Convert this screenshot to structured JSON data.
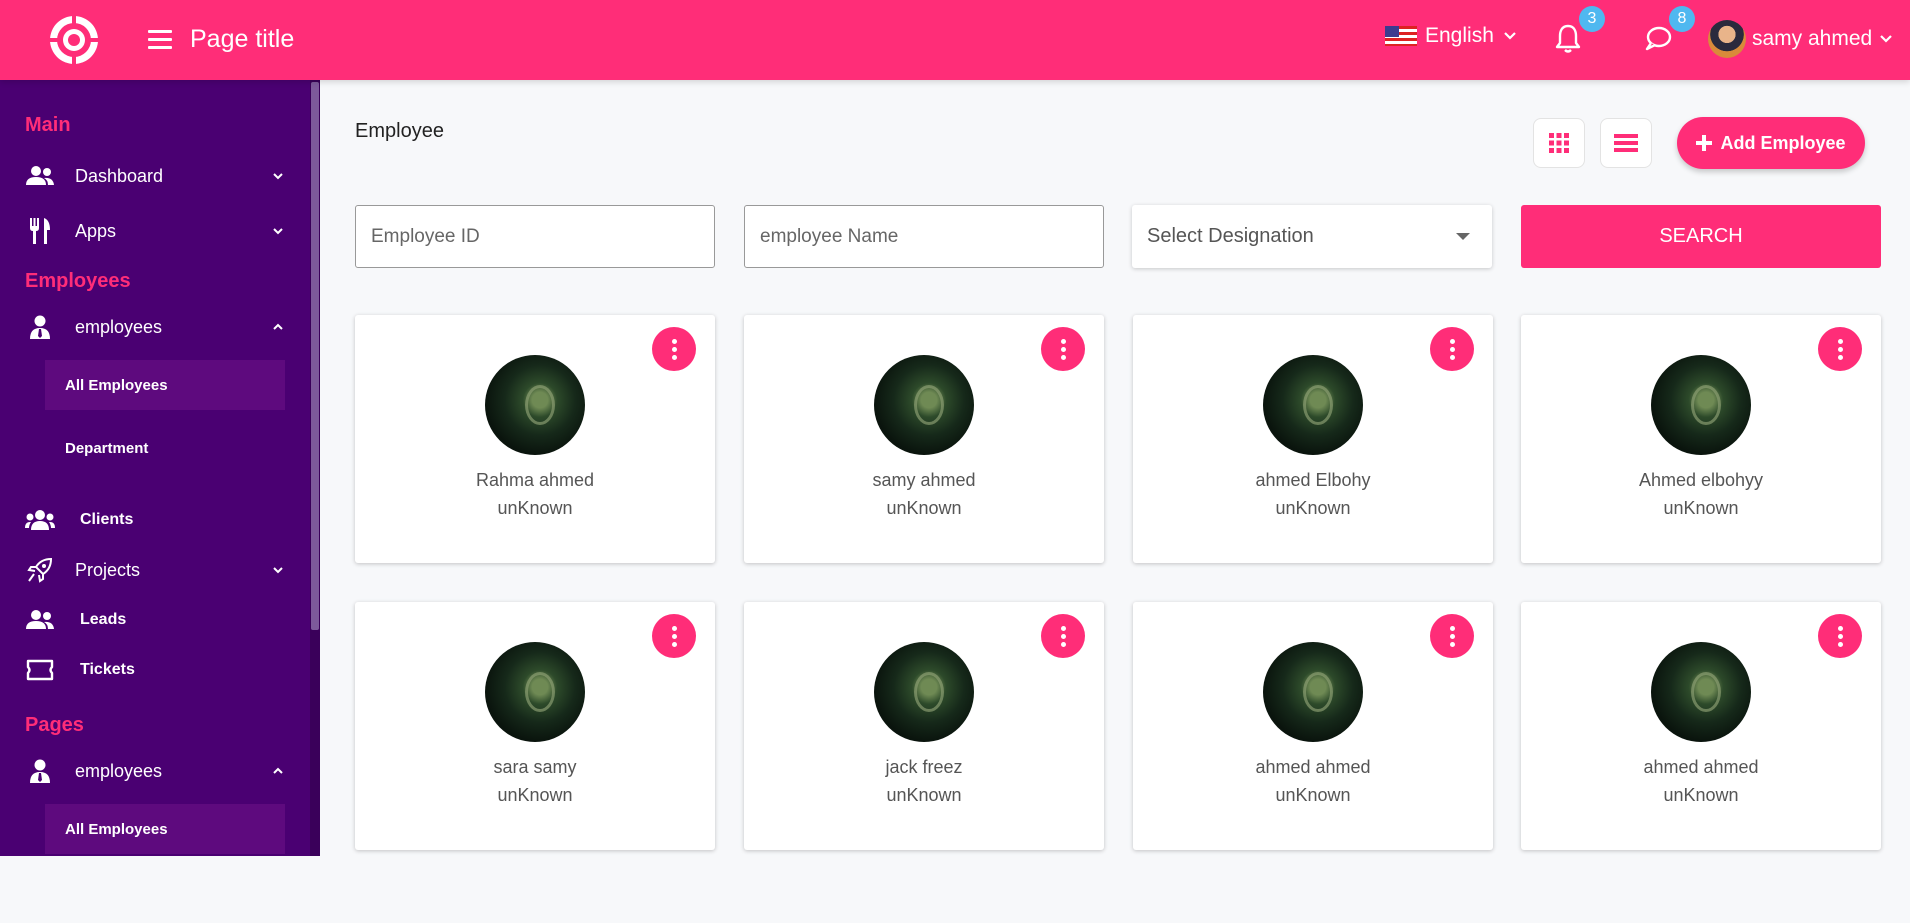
{
  "header": {
    "page_title": "Page title",
    "language": "English",
    "notifications_count": "3",
    "messages_count": "8",
    "user_name": "samy ahmed"
  },
  "sidebar": {
    "sections": {
      "main": "Main",
      "employees": "Employees",
      "pages": "Pages"
    },
    "items": {
      "dashboard": "Dashboard",
      "apps": "Apps",
      "employees": "employees",
      "all_employees": "All Employees",
      "department": "Department",
      "clients": "Clients",
      "projects": "Projects",
      "leads": "Leads",
      "tickets": "Tickets",
      "pages_employees": "employees",
      "pages_all_employees": "All Employees"
    }
  },
  "main": {
    "title": "Employee",
    "add_button": "Add Employee",
    "filters": {
      "employee_id_placeholder": "Employee ID",
      "employee_name_placeholder": "employee Name",
      "designation": "Select Designation",
      "search": "SEARCH"
    },
    "employees": [
      {
        "name": "Rahma ahmed",
        "role": "unKnown"
      },
      {
        "name": "samy ahmed",
        "role": "unKnown"
      },
      {
        "name": "ahmed Elbohy",
        "role": "unKnown"
      },
      {
        "name": "Ahmed elbohyy",
        "role": "unKnown"
      },
      {
        "name": "sara samy",
        "role": "unKnown"
      },
      {
        "name": "jack freez",
        "role": "unKnown"
      },
      {
        "name": "ahmed ahmed",
        "role": "unKnown"
      },
      {
        "name": "ahmed ahmed",
        "role": "unKnown"
      }
    ]
  },
  "colors": {
    "accent": "#ff2d78",
    "sidebar": "#4a0072",
    "badge": "#4fb8f0"
  }
}
